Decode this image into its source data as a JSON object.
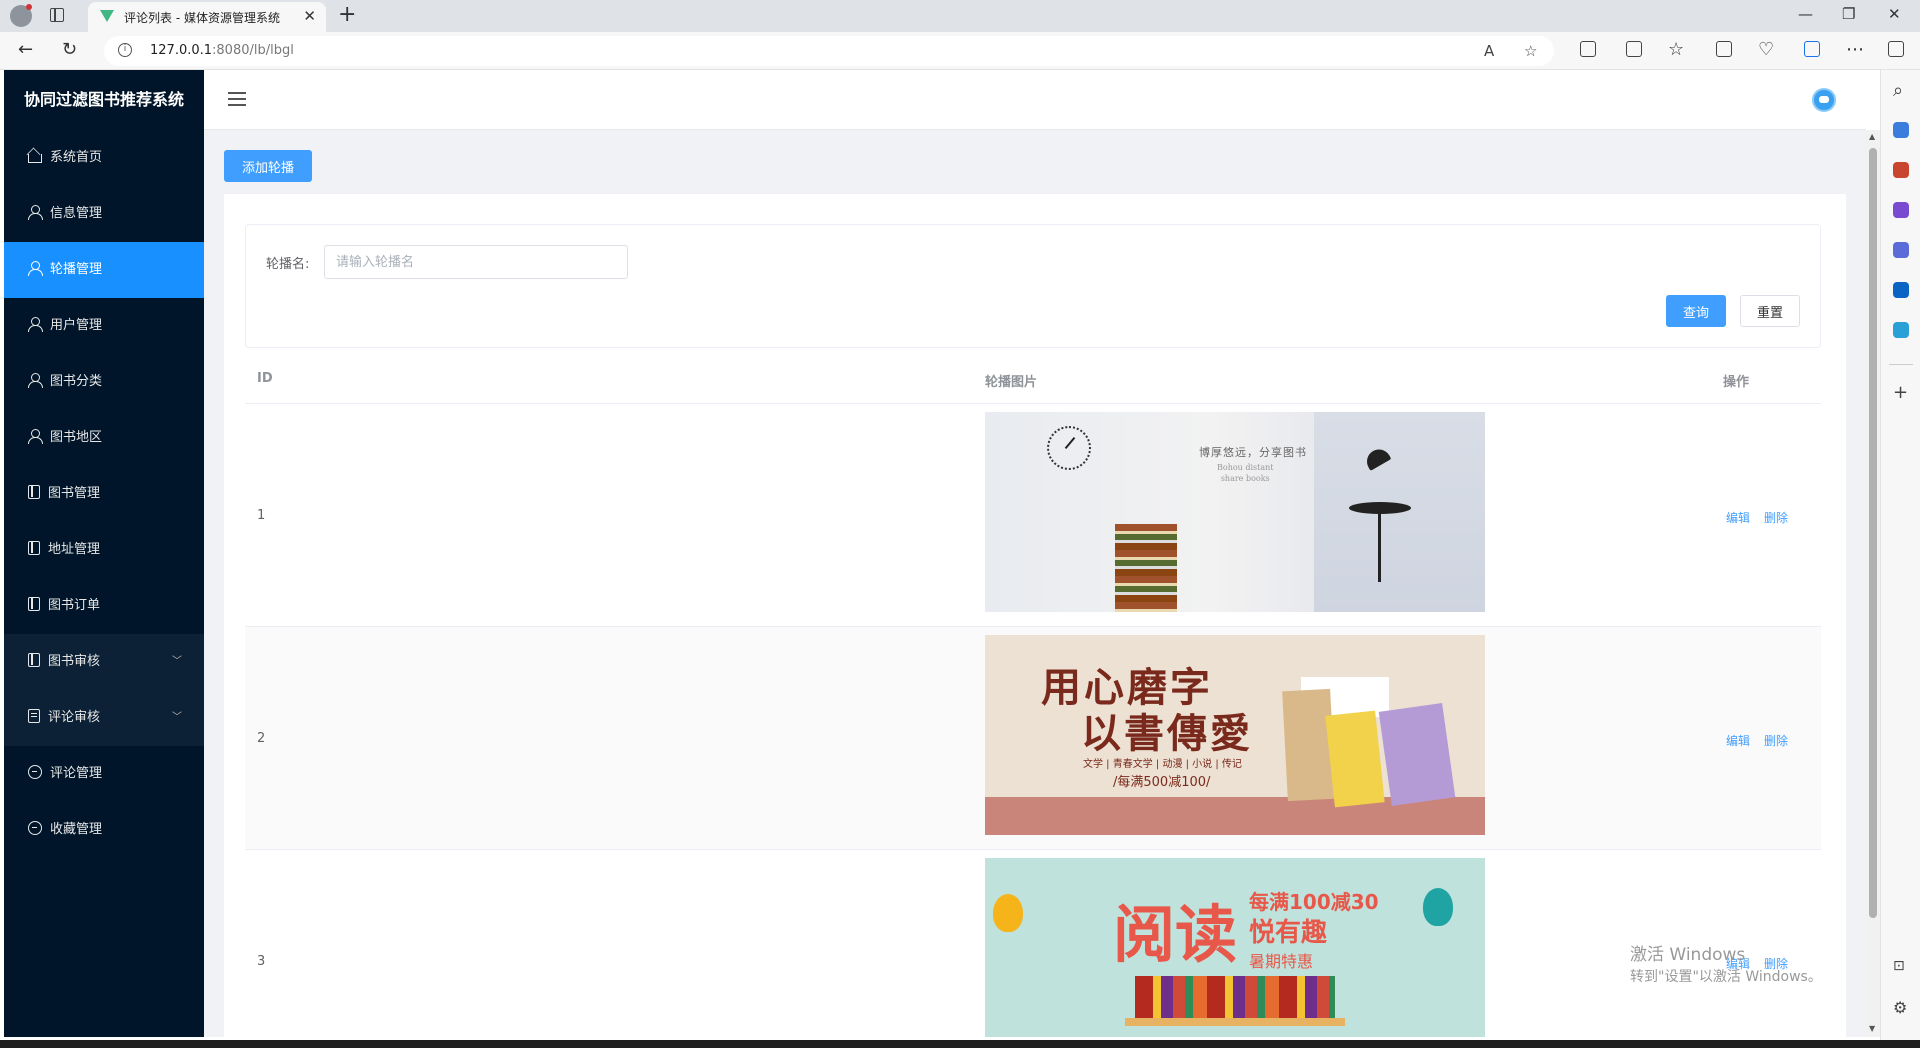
{
  "browser": {
    "tab_title": "评论列表 - 媒体资源管理系统",
    "url_host": "127.0.0.1",
    "url_rest": ":8080/lb/lbgl"
  },
  "app": {
    "title": "协同过滤图书推荐系统"
  },
  "sidebar": {
    "items": [
      {
        "label": "系统首页",
        "icon": "home-icon"
      },
      {
        "label": "信息管理",
        "icon": "user-icon"
      },
      {
        "label": "轮播管理",
        "icon": "user-icon",
        "active": true
      },
      {
        "label": "用户管理",
        "icon": "user-icon"
      },
      {
        "label": "图书分类",
        "icon": "user-icon"
      },
      {
        "label": "图书地区",
        "icon": "user-icon"
      },
      {
        "label": "图书管理",
        "icon": "book-icon"
      },
      {
        "label": "地址管理",
        "icon": "book-icon"
      },
      {
        "label": "图书订单",
        "icon": "book-icon"
      },
      {
        "label": "图书审核",
        "icon": "book-icon",
        "expandable": true
      },
      {
        "label": "评论审核",
        "icon": "document-icon",
        "expandable": true
      },
      {
        "label": "评论管理",
        "icon": "chat-icon"
      },
      {
        "label": "收藏管理",
        "icon": "chat-icon"
      }
    ]
  },
  "toolbar": {
    "add_label": "添加轮播"
  },
  "search": {
    "label": "轮播名:",
    "placeholder": "请输入轮播名",
    "query_label": "查询",
    "reset_label": "重置"
  },
  "table": {
    "headers": {
      "id": "ID",
      "image": "轮播图片",
      "ops": "操作"
    },
    "rows": [
      {
        "id": "1",
        "banner": {
          "text": "博厚悠远，分享图书",
          "sub1": "Bohou distant",
          "sub2": "share books"
        }
      },
      {
        "id": "2",
        "banner": {
          "line1": "用心磨字",
          "line2": "以書傳愛",
          "line3": "文学 | 青春文学 | 动漫 | 小说 | 传记",
          "line4": "/每满500减100/"
        }
      },
      {
        "id": "3",
        "banner": {
          "big": "阅读",
          "r1": "每满100减30",
          "r2": "悦有趣",
          "r3": "暑期特惠"
        }
      }
    ],
    "edit_label": "编辑",
    "delete_label": "删除"
  },
  "watermark": {
    "line1": "激活 Windows",
    "line2": "转到\"设置\"以激活 Windows。"
  },
  "colors": {
    "sidebar_bg": "#001529",
    "active": "#1890ff",
    "primary": "#409eff"
  }
}
